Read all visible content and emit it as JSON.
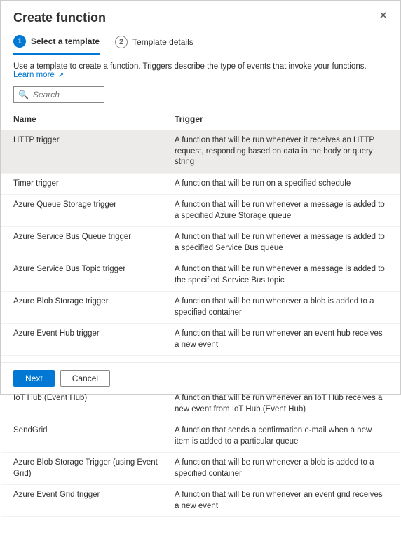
{
  "dialog": {
    "title": "Create function",
    "close_symbol": "✕"
  },
  "stepper": {
    "steps": [
      {
        "num": "1",
        "label": "Select a template",
        "active": true
      },
      {
        "num": "2",
        "label": "Template details",
        "active": false
      }
    ]
  },
  "description": {
    "text": "Use a template to create a function. Triggers describe the type of events that invoke your functions. ",
    "link_text": "Learn more",
    "ext_glyph": "↗"
  },
  "search": {
    "placeholder": "Search",
    "icon_glyph": "🔍"
  },
  "table": {
    "columns": {
      "name": "Name",
      "trigger": "Trigger"
    },
    "rows": [
      {
        "name": "HTTP trigger",
        "trigger": "A function that will be run whenever it receives an HTTP request, responding based on data in the body or query string",
        "selected": true
      },
      {
        "name": "Timer trigger",
        "trigger": "A function that will be run on a specified schedule",
        "selected": false
      },
      {
        "name": "Azure Queue Storage trigger",
        "trigger": "A function that will be run whenever a message is added to a specified Azure Storage queue",
        "selected": false
      },
      {
        "name": "Azure Service Bus Queue trigger",
        "trigger": "A function that will be run whenever a message is added to a specified Service Bus queue",
        "selected": false
      },
      {
        "name": "Azure Service Bus Topic trigger",
        "trigger": "A function that will be run whenever a message is added to the specified Service Bus topic",
        "selected": false
      },
      {
        "name": "Azure Blob Storage trigger",
        "trigger": "A function that will be run whenever a blob is added to a specified container",
        "selected": false
      },
      {
        "name": "Azure Event Hub trigger",
        "trigger": "A function that will be run whenever an event hub receives a new event",
        "selected": false
      },
      {
        "name": "Azure Cosmos DB trigger",
        "trigger": "A function that will be run whenever documents change in a document collection",
        "selected": false
      },
      {
        "name": "IoT Hub (Event Hub)",
        "trigger": "A function that will be run whenever an IoT Hub receives a new event from IoT Hub (Event Hub)",
        "selected": false
      },
      {
        "name": "SendGrid",
        "trigger": "A function that sends a confirmation e-mail when a new item is added to a particular queue",
        "selected": false
      },
      {
        "name": "Azure Blob Storage Trigger (using Event Grid)",
        "trigger": "A function that will be run whenever a blob is added to a specified container",
        "selected": false
      },
      {
        "name": "Azure Event Grid trigger",
        "trigger": "A function that will be run whenever an event grid receives a new event",
        "selected": false
      }
    ]
  },
  "footer": {
    "next": "Next",
    "cancel": "Cancel"
  }
}
